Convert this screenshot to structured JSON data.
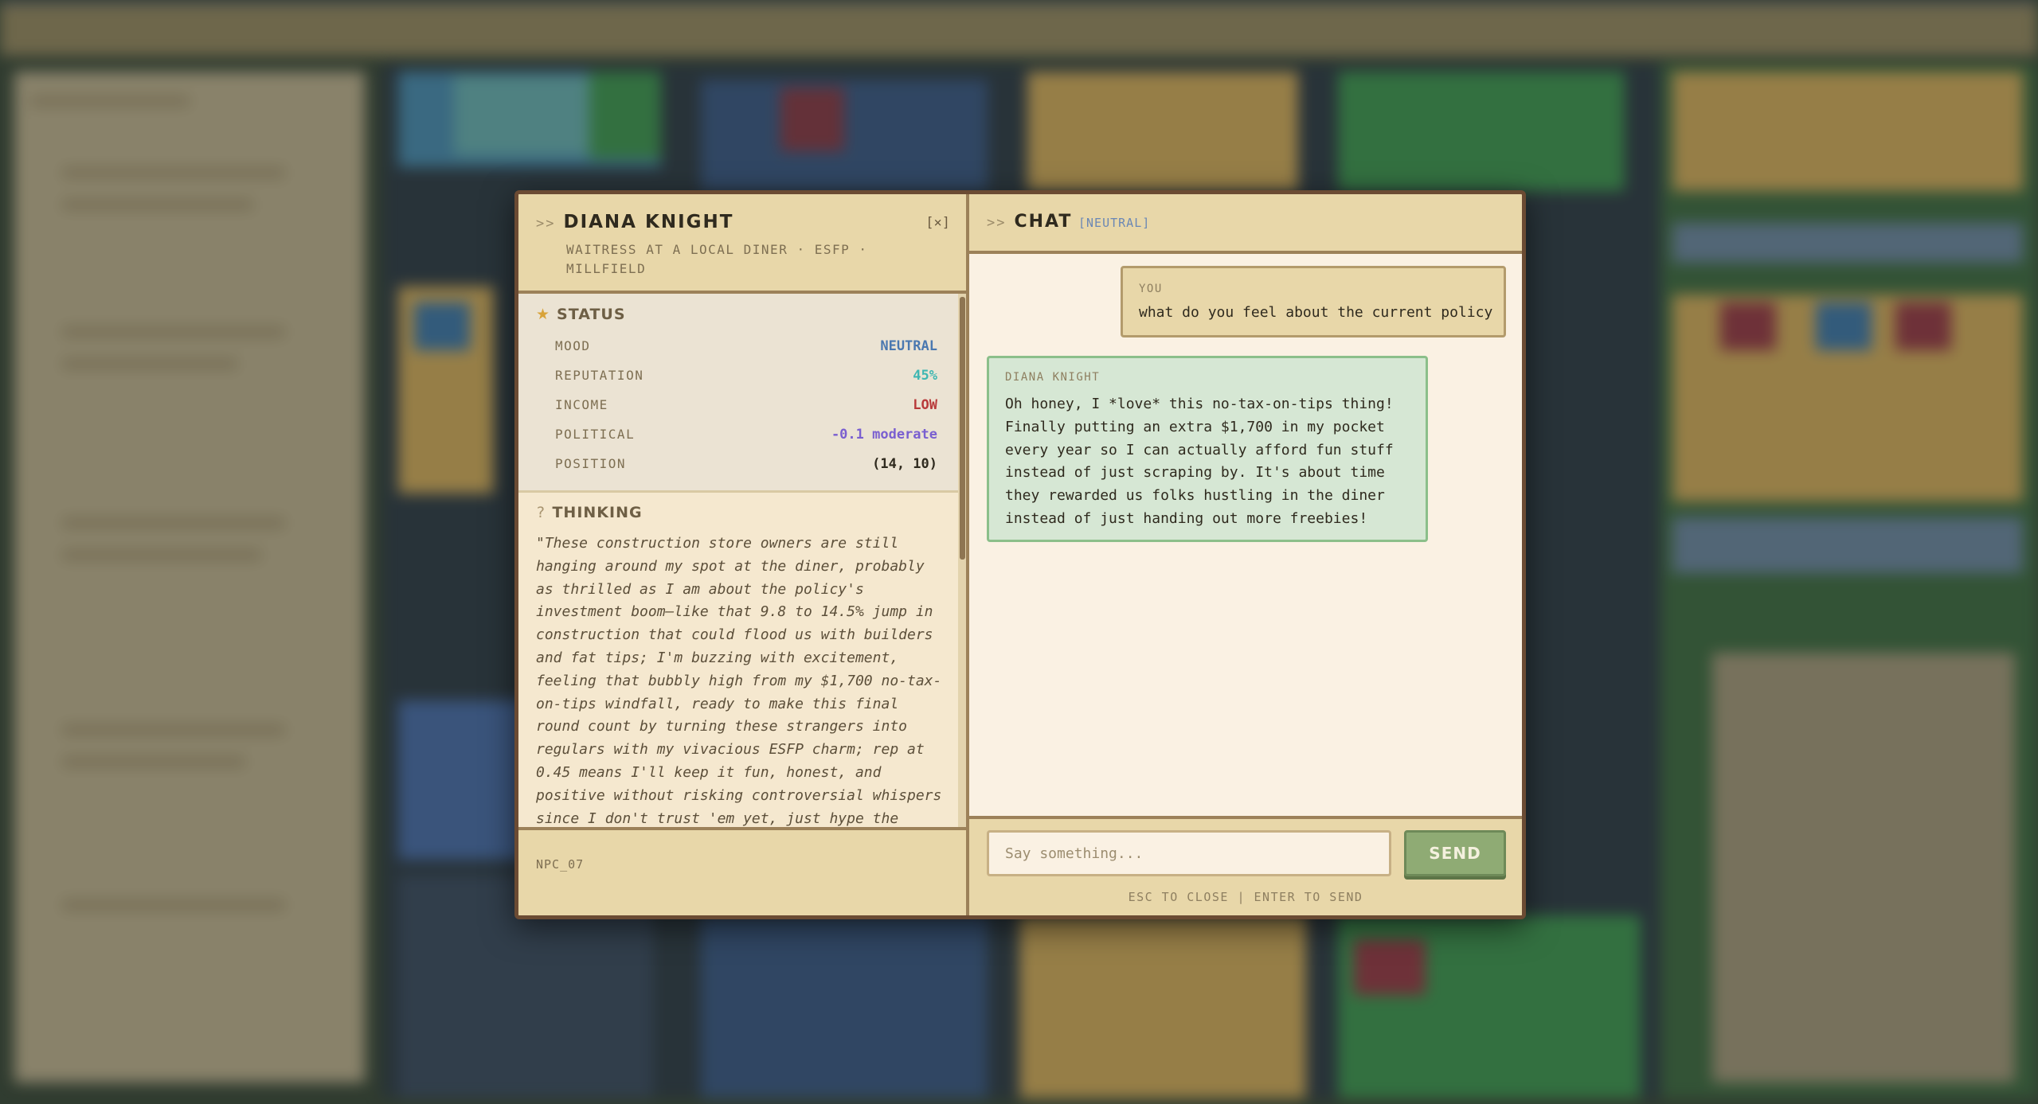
{
  "npc": {
    "name": "DIANA KNIGHT",
    "subtitle": "WAITRESS AT A LOCAL DINER · ESFP · MILLFIELD",
    "close_label": "[×]",
    "header_prefix": ">>",
    "id": "NPC_07"
  },
  "status": {
    "title": "STATUS",
    "rows": [
      {
        "label": "MOOD",
        "value": "NEUTRAL",
        "color": "#4a78b0"
      },
      {
        "label": "REPUTATION",
        "value": "45%",
        "color": "#3fb7b2"
      },
      {
        "label": "INCOME",
        "value": "LOW",
        "color": "#b83a3a"
      },
      {
        "label": "POLITICAL",
        "value": "-0.1 moderate",
        "color": "#7a5fd0"
      },
      {
        "label": "POSITION",
        "value": "(14, 10)",
        "color": "#2f2a1e"
      }
    ]
  },
  "thinking": {
    "title": "THINKING",
    "text": "\"These construction store owners are still hanging around my spot at the diner, probably as thrilled as I am about the policy's investment boom—like that 9.8 to 14.5% jump in construction that could flood us with builders and fat tips; I'm buzzing with excitement, feeling that bubbly high from my $1,700 no-tax-on-tips windfall, ready to make this final round count by turning these strangers into regulars with my vivacious ESFP charm; rep at 0.45 means I'll keep it fun, honest, and positive without risking controversial whispers since I don't trust 'em yet, just hype the hustle perks to build diner connections before"
  },
  "chat": {
    "title": "CHAT",
    "prefix": ">>",
    "mood_tag": "[NEUTRAL]",
    "messages": [
      {
        "who": "YOU",
        "text": "what do you feel about the current policy"
      },
      {
        "who": "DIANA KNIGHT",
        "text": "Oh honey, I *love* this no-tax-on-tips thing! Finally putting an extra $1,700 in my pocket every year so I can actually afford fun stuff instead of just scraping by. It's about time they rewarded us folks hustling in the diner instead of just handing out more freebies!"
      }
    ],
    "input_placeholder": "Say something...",
    "send_label": "SEND",
    "hint": "ESC TO CLOSE | ENTER TO SEND"
  }
}
